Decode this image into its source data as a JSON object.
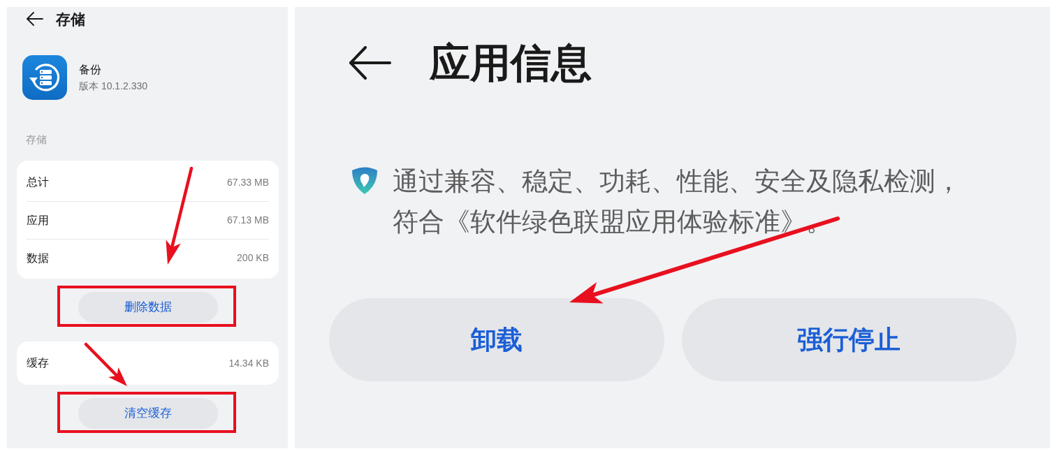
{
  "left_panel": {
    "header": {
      "title": "存储"
    },
    "app": {
      "name": "备份",
      "version": "版本 10.1.2.330"
    },
    "section_label": "存储",
    "groups": [
      {
        "rows": [
          {
            "label": "总计",
            "value": "67.33 MB"
          },
          {
            "label": "应用",
            "value": "67.13 MB"
          },
          {
            "label": "数据",
            "value": "200 KB"
          }
        ],
        "action": {
          "label": "删除数据",
          "highlighted": true
        }
      },
      {
        "rows": [
          {
            "label": "缓存",
            "value": "14.34 KB"
          }
        ],
        "action": {
          "label": "清空缓存",
          "highlighted": true
        }
      }
    ]
  },
  "right_panel": {
    "header": {
      "title": "应用信息"
    },
    "certification": "通过兼容、稳定、功耗、性能、安全及隐私检测，符合《软件绿色联盟应用体验标准》。",
    "buttons": [
      {
        "label": "卸载"
      },
      {
        "label": "强行停止"
      }
    ]
  }
}
